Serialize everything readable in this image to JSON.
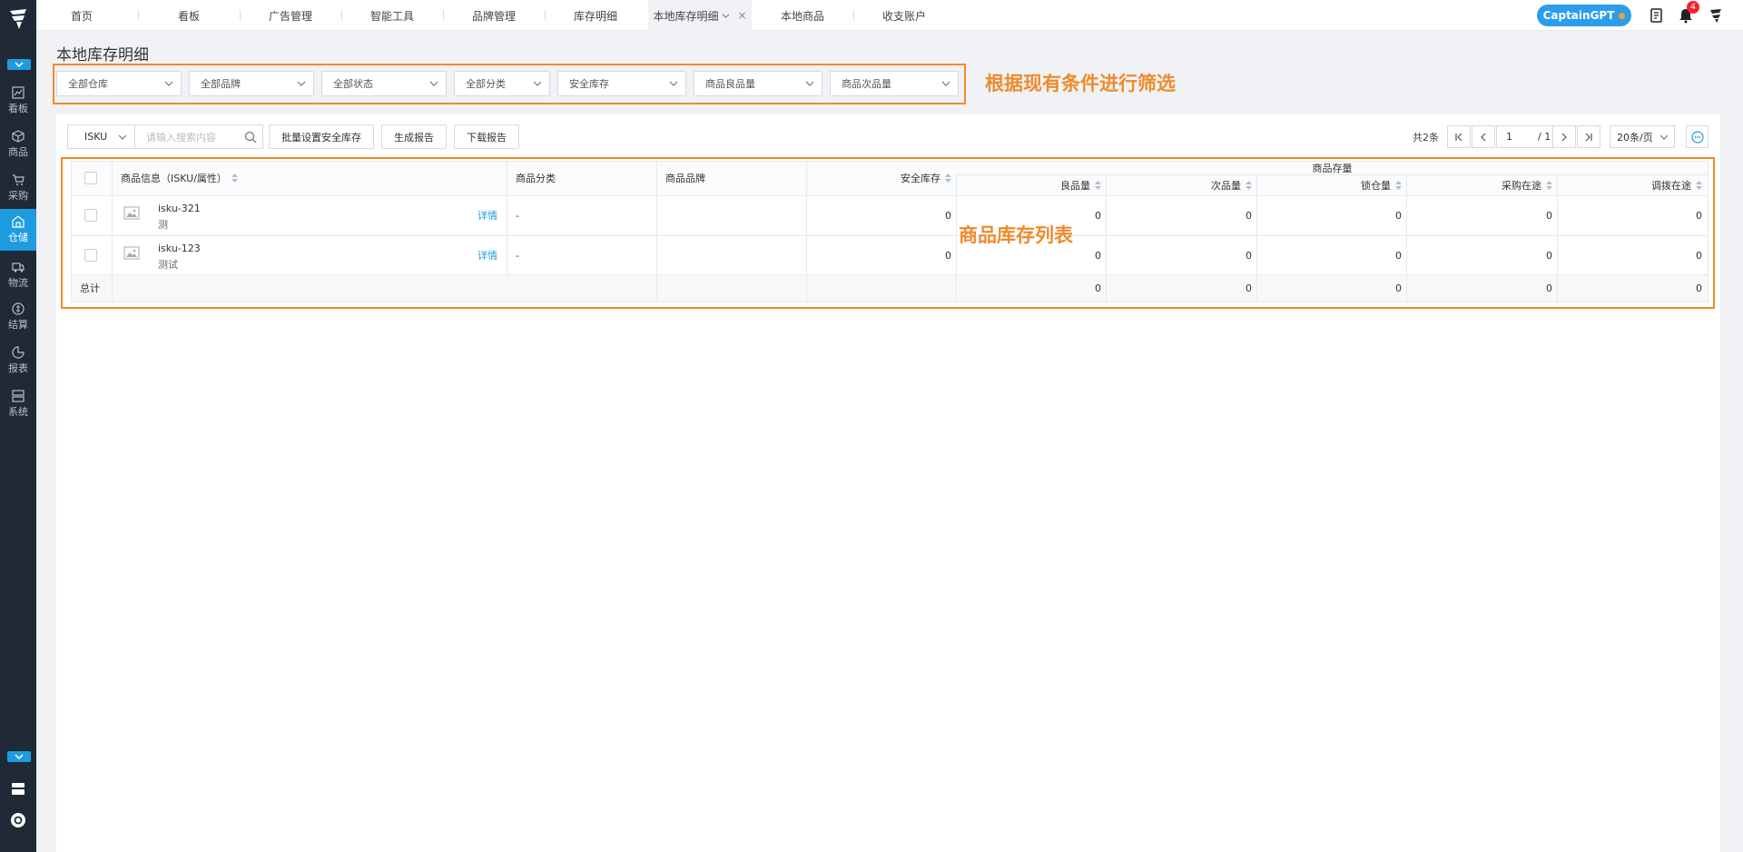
{
  "tabs": [
    {
      "label": "首页"
    },
    {
      "label": "看板"
    },
    {
      "label": "广告管理"
    },
    {
      "label": "智能工具"
    },
    {
      "label": "品牌管理"
    },
    {
      "label": "库存明细"
    },
    {
      "label": "本地库存明细"
    },
    {
      "label": "本地商品"
    },
    {
      "label": "收支账户"
    }
  ],
  "header": {
    "gpt_label": "CaptainGPT",
    "notif_count": "4"
  },
  "sidebar": {
    "items": [
      {
        "label": "看板",
        "icon": "chart-icon"
      },
      {
        "label": "商品",
        "icon": "box-icon"
      },
      {
        "label": "采购",
        "icon": "cart-icon"
      },
      {
        "label": "仓储",
        "icon": "warehouse-icon"
      },
      {
        "label": "物流",
        "icon": "truck-icon"
      },
      {
        "label": "结算",
        "icon": "coin-icon"
      },
      {
        "label": "报表",
        "icon": "pie-icon"
      },
      {
        "label": "系统",
        "icon": "server-icon"
      }
    ]
  },
  "page_title": "本地库存明细",
  "filters": [
    "全部仓库",
    "全部品牌",
    "全部状态",
    "全部分类",
    "安全库存",
    "商品良品量",
    "商品次品量"
  ],
  "annotations": {
    "filter": "根据现有条件进行筛选",
    "table": "商品库存列表"
  },
  "toolbar": {
    "search_type": "ISKU",
    "search_placeholder": "请输入搜索内容",
    "batch_button": "批量设置安全库存",
    "report_button": "生成报告",
    "download_button": "下载报告"
  },
  "pager": {
    "total": "共2条",
    "page": "1",
    "pages": "/ 1",
    "page_size": "20条/页"
  },
  "table": {
    "headers": {
      "product": "商品信息（ISKU/属性）",
      "category": "商品分类",
      "brand": "商品品牌",
      "safety": "安全库存",
      "stock_group": "商品存量",
      "good": "良品量",
      "defect": "次品量",
      "locked": "锁仓量",
      "purchase": "采购在途",
      "transfer": "调拨在途"
    },
    "detail_label": "详情",
    "rows": [
      {
        "isku": "isku-321",
        "attr": "测",
        "category": "-",
        "brand": "",
        "safety": "0",
        "good": "0",
        "defect": "0",
        "locked": "0",
        "purchase": "0",
        "transfer": "0"
      },
      {
        "isku": "isku-123",
        "attr": "测试",
        "category": "-",
        "brand": "",
        "safety": "0",
        "good": "0",
        "defect": "0",
        "locked": "0",
        "purchase": "0",
        "transfer": "0"
      }
    ],
    "total": {
      "label": "总计",
      "good": "0",
      "defect": "0",
      "locked": "0",
      "purchase": "0",
      "transfer": "0"
    }
  }
}
